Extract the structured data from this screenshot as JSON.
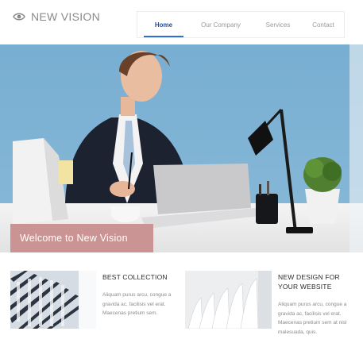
{
  "brand": {
    "name": "NEW VISION",
    "icon": "eye-icon"
  },
  "nav": {
    "items": [
      {
        "label": "Home",
        "active": true
      },
      {
        "label": "Our Company",
        "active": false
      },
      {
        "label": "Services",
        "active": false
      },
      {
        "label": "Contact",
        "active": false
      }
    ]
  },
  "hero": {
    "banner_text": "Welcome to New Vision"
  },
  "features": [
    {
      "title": "BEST COLLECTION",
      "text": "Aliquam purus arcu, congue a gravida ac, facilisis vel erat. Maecenas pretium sem."
    },
    {
      "title": "NEW DESIGN FOR YOUR WEBSITE",
      "text": "Aliquam purus arcu, congue a gravida ac, facilisis vel erat. Maecenas pretium sem at nisl malesuada, quis."
    }
  ],
  "colors": {
    "accent": "#2e6fd6",
    "banner": "#c99493",
    "hero_wall": "#7fb0d2",
    "text_muted": "#8b8b8b"
  }
}
